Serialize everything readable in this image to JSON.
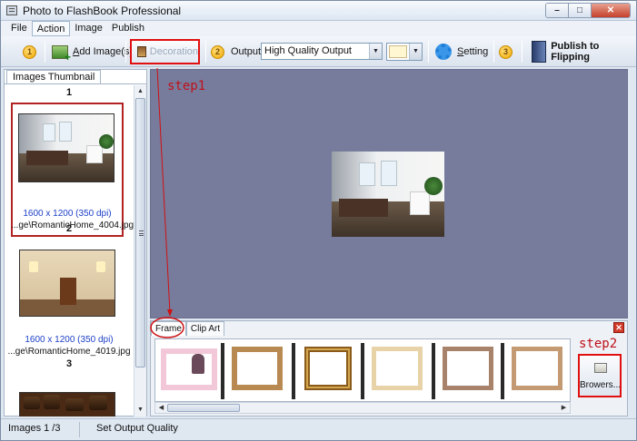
{
  "window": {
    "title": "Photo to FlashBook Professional"
  },
  "menu": {
    "items": [
      "File",
      "Action",
      "Image",
      "Publish"
    ],
    "active_index": 1
  },
  "toolbar": {
    "step1_badge": "1",
    "add_images_prefix": "A",
    "add_images_rest": "dd Image(s)",
    "decoration_label": "Decoration",
    "step2_badge": "2",
    "output_label": "Output:",
    "output_value": "High Quality Output",
    "setting_prefix": "S",
    "setting_rest": "etting",
    "step3_badge": "3",
    "publish_label": "Publish to Flipping",
    "background_color": "#fff6d2"
  },
  "left_panel": {
    "tab_label": "Images Thumbnail",
    "thumbnails": [
      {
        "number": "1",
        "info": "1600 x 1200 (350 dpi)",
        "file": "...ge\\RomanticHome_4004.jpg",
        "selected": true
      },
      {
        "number": "2",
        "info": "1600 x 1200 (350 dpi)",
        "file": "...ge\\RomanticHome_4019.jpg",
        "selected": false
      },
      {
        "number": "3"
      }
    ]
  },
  "frame_panel": {
    "tabs": [
      "Frame",
      "Clip Art"
    ],
    "active_tab": "Frame",
    "frame_count": 6,
    "browse_label": "Browers..."
  },
  "annotations": {
    "step1": "step1",
    "step2": "step2",
    "color": "#d01010"
  },
  "status": {
    "images": "Images 1 /3",
    "message": "Set Output Quality"
  },
  "colors": {
    "preview_bg": "#777c9d",
    "selection_border": "#b22222",
    "link_text": "#1c3fc8"
  }
}
